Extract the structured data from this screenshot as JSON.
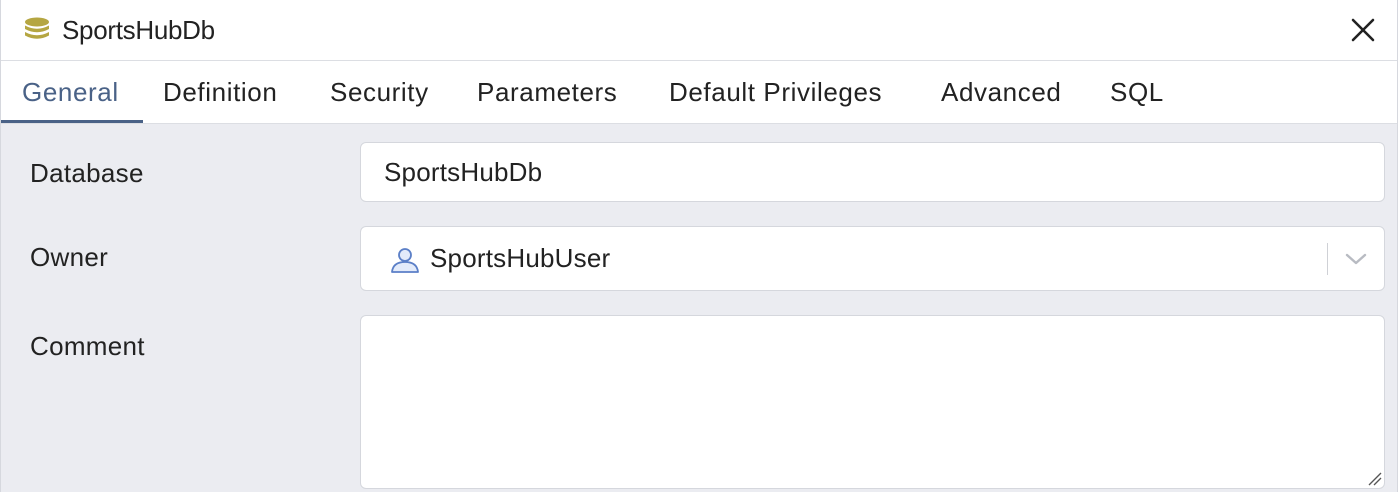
{
  "dialog": {
    "title": "SportsHubDb",
    "title_icon": "database-icon",
    "close_icon": "close-icon"
  },
  "tabs": [
    {
      "label": "General",
      "active": true
    },
    {
      "label": "Definition",
      "active": false
    },
    {
      "label": "Security",
      "active": false
    },
    {
      "label": "Parameters",
      "active": false
    },
    {
      "label": "Default Privileges",
      "active": false
    },
    {
      "label": "Advanced",
      "active": false
    },
    {
      "label": "SQL",
      "active": false
    }
  ],
  "form": {
    "database": {
      "label": "Database",
      "value": "SportsHubDb"
    },
    "owner": {
      "label": "Owner",
      "value": "SportsHubUser",
      "icon": "user-icon"
    },
    "comment": {
      "label": "Comment",
      "value": ""
    }
  },
  "colors": {
    "accent": "#4a6287",
    "db_icon": "#b5a642",
    "user_icon": "#5b7fc7",
    "background": "#ebecf1"
  }
}
